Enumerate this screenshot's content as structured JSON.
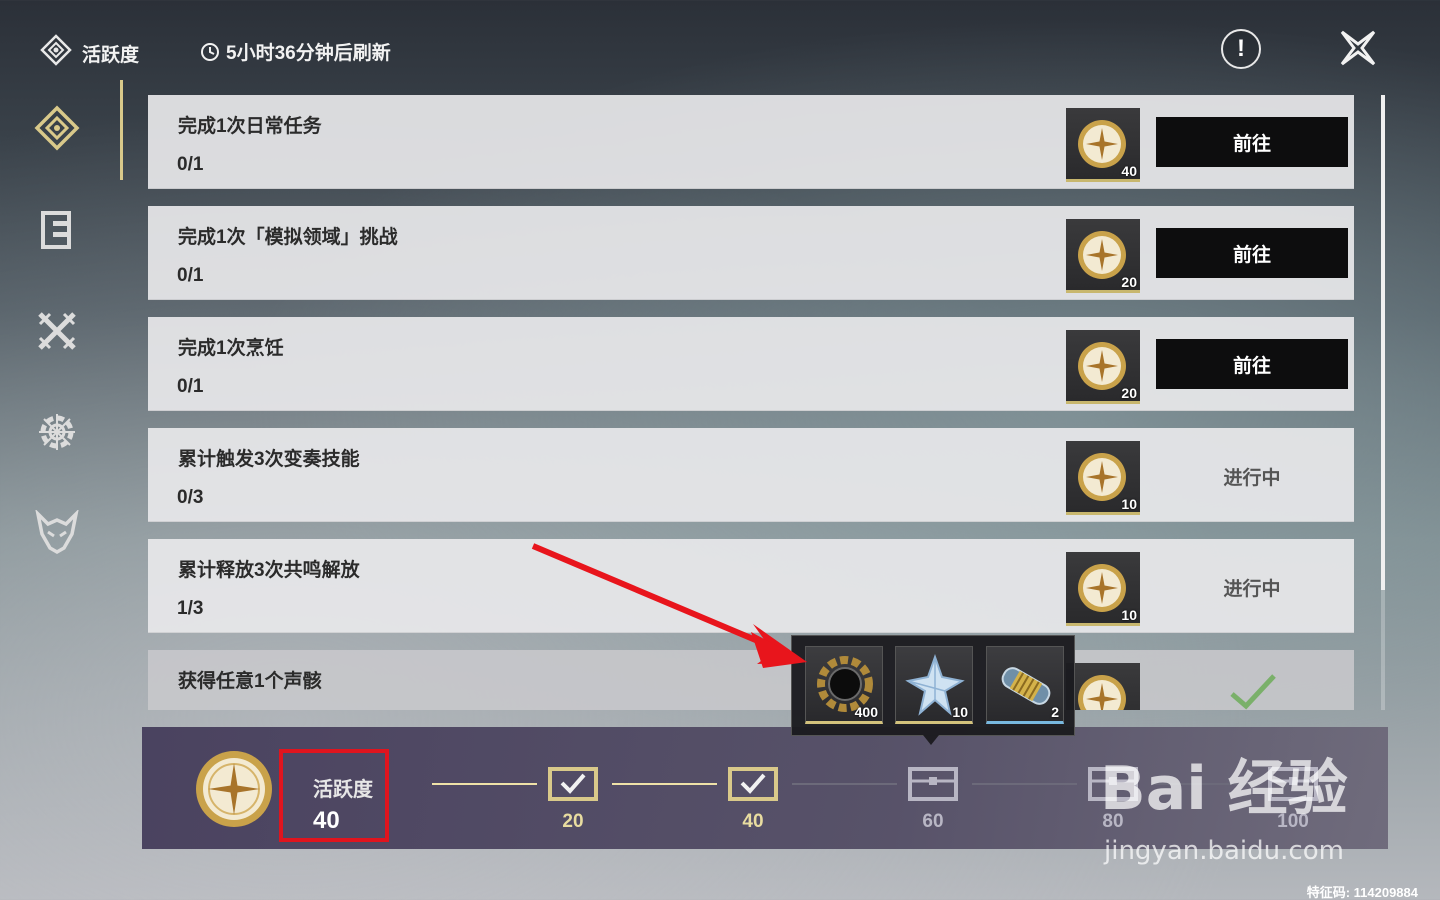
{
  "header": {
    "title": "活跃度",
    "refresh_text": "5小时36分钟后刷新",
    "info_label": "!"
  },
  "sidebar": {
    "items": [
      {
        "icon": "activity-diamond-icon",
        "active": true
      },
      {
        "icon": "quest-book-icon",
        "active": false
      },
      {
        "icon": "crossed-swords-icon",
        "active": false
      },
      {
        "icon": "snowflake-gear-icon",
        "active": false
      },
      {
        "icon": "beast-mask-icon",
        "active": false
      }
    ]
  },
  "tasks": [
    {
      "name": "完成1次日常任务",
      "progress": "0/1",
      "reward": "40",
      "action": "前往",
      "state": "go"
    },
    {
      "name": "完成1次「模拟领域」挑战",
      "progress": "0/1",
      "reward": "20",
      "action": "前往",
      "state": "go"
    },
    {
      "name": "完成1次烹饪",
      "progress": "0/1",
      "reward": "20",
      "action": "前往",
      "state": "go"
    },
    {
      "name": "累计触发3次变奏技能",
      "progress": "0/3",
      "reward": "10",
      "action": "进行中",
      "state": "in-progress"
    },
    {
      "name": "累计释放3次共鸣解放",
      "progress": "1/3",
      "reward": "10",
      "action": "进行中",
      "state": "in-progress"
    },
    {
      "name": "获得任意1个声骸",
      "progress": "",
      "reward": "",
      "action": "",
      "state": "done"
    }
  ],
  "activity": {
    "label": "活跃度",
    "value": "40",
    "milestones": [
      {
        "value": "20",
        "reached": true
      },
      {
        "value": "40",
        "reached": true
      },
      {
        "value": "60",
        "reached": false
      },
      {
        "value": "80",
        "reached": false
      },
      {
        "value": "100",
        "reached": false
      }
    ]
  },
  "popup": {
    "items": [
      {
        "icon": "shell-credit-gear-icon",
        "count": "400",
        "rarity": "gold"
      },
      {
        "icon": "star-crystal-icon",
        "count": "10",
        "rarity": "gold"
      },
      {
        "icon": "energy-capsule-icon",
        "count": "2",
        "rarity": "blue"
      }
    ]
  },
  "watermark": {
    "line1": "Bai 经验",
    "line2": "jingyan.baidu.com",
    "footer": "特征码: 114209884"
  },
  "colors": {
    "accent_gold": "#d9c98a",
    "annotation_red": "#e0141e",
    "button_black": "#0d0d0e"
  }
}
